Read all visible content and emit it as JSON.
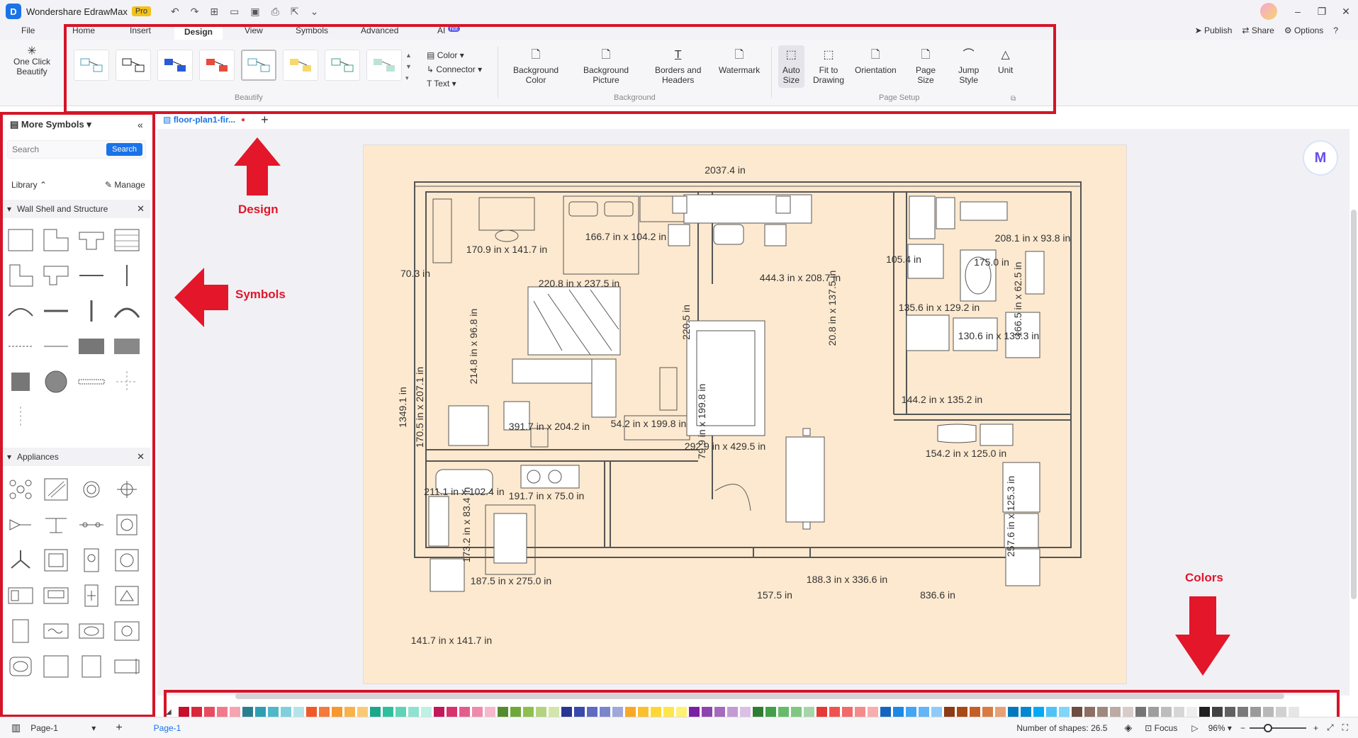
{
  "app": {
    "name": "Wondershare EdrawMax",
    "badge": "Pro"
  },
  "menu": {
    "file": "File",
    "tabs": [
      "Home",
      "Insert",
      "Design",
      "View",
      "Symbols",
      "Advanced",
      "AI"
    ],
    "ai_badge": "hot"
  },
  "topright": {
    "publish": "Publish",
    "share": "Share",
    "options": "Options"
  },
  "ribbon": {
    "one_click_line1": "One Click",
    "one_click_line2": "Beautify",
    "beautify_group": "Beautify",
    "options": [
      "Color",
      "Connector",
      "Text"
    ],
    "background_group": "Background",
    "page_setup_group": "Page Setup",
    "buttons": [
      {
        "line1": "Background",
        "line2": "Color"
      },
      {
        "line1": "Background",
        "line2": "Picture"
      },
      {
        "line1": "Borders and",
        "line2": "Headers"
      },
      {
        "line1": "Watermark",
        "line2": ""
      },
      {
        "line1": "Auto",
        "line2": "Size"
      },
      {
        "line1": "Fit to",
        "line2": "Drawing"
      },
      {
        "line1": "Orientation",
        "line2": ""
      },
      {
        "line1": "Page",
        "line2": "Size"
      },
      {
        "line1": "Jump",
        "line2": "Style"
      },
      {
        "line1": "Unit",
        "line2": ""
      }
    ]
  },
  "sidebar": {
    "title": "More Symbols",
    "search_placeholder": "Search",
    "search_button": "Search",
    "library": "Library",
    "manage": "Manage",
    "categories": [
      "Wall Shell and Structure",
      "Appliances"
    ]
  },
  "document": {
    "tab": "floor-plan1-fir...",
    "page": "Page-1"
  },
  "floorplan": {
    "labels": [
      "2037.4 in",
      "170.9 in x 141.7 in",
      "166.7 in x 104.2 in",
      "444.3 in x 208.7 in",
      "208.1 in x 93.8 in",
      "70.3 in",
      "214.8 in x 96.8 in",
      "220.8 in x 237.5 in",
      "220.5 in",
      "20.8 in x 137.5 in",
      "135.6 in x 129.2 in",
      "130.6 in x 133.3 in",
      "1349.1 in",
      "170.5 in x 207.1 in",
      "391.7 in x 204.2 in",
      "54.2 in x 199.8 in",
      "292.9 in x 429.5 in",
      "144.2 in x 135.2 in",
      "154.2 in x 125.0 in",
      "211.1 in x 102.4 in",
      "191.7 in x 75.0 in",
      "173.2 in x 83.4 in",
      "187.5 in x 275.0 in",
      "157.5 in",
      "188.3 in x 336.6 in",
      "836.6 in",
      "141.7 in x 141.7 in",
      "79.9 in x 199.8 in",
      "257.6 in x 125.3 in",
      "166.5 in x 62.5 in",
      "105.4 in",
      "175.0 in"
    ]
  },
  "annotations": {
    "design": "Design",
    "symbols": "Symbols",
    "colors": "Colors"
  },
  "status": {
    "shapes": "Number of shapes: 26.5",
    "focus": "Focus",
    "zoom": "96%"
  },
  "colors": [
    "#c8102e",
    "#d9263a",
    "#e94b5e",
    "#f07a8a",
    "#f6a4b0",
    "#2a7f8f",
    "#2e9fb3",
    "#4cb8c8",
    "#7fd0dc",
    "#b4e4ea",
    "#f05a28",
    "#f47a3d",
    "#f7972e",
    "#f9b24a",
    "#fbc976",
    "#1aa88a",
    "#2fbf9f",
    "#5fd3b8",
    "#8fe2cf",
    "#bff0e4",
    "#c2185b",
    "#d6336c",
    "#e35d8c",
    "#ee8bad",
    "#f5b8cc",
    "#558b2f",
    "#6fa83a",
    "#8fc04f",
    "#b2d47d",
    "#d2e6aa",
    "#283593",
    "#3949ab",
    "#5c6bc0",
    "#7986cb",
    "#9fa8da",
    "#f9a825",
    "#fbc02d",
    "#fdd835",
    "#ffe54c",
    "#fff176",
    "#7b1fa2",
    "#8e44ad",
    "#a569bd",
    "#c39bd3",
    "#dbbfe6",
    "#2e7d32",
    "#43a047",
    "#66bb6a",
    "#81c784",
    "#a5d6a7",
    "#e53935",
    "#ef5350",
    "#f06a6a",
    "#f48b8b",
    "#f7aeae",
    "#1565c0",
    "#1e88e5",
    "#42a5f5",
    "#64b5f6",
    "#90caf9",
    "#8d3b12",
    "#a84a16",
    "#c45e26",
    "#d97b44",
    "#e8a077",
    "#0277bd",
    "#0288d1",
    "#03a9f4",
    "#4fc3f7",
    "#81d4fa",
    "#6d4c41",
    "#8d6e63",
    "#a1887f",
    "#bcaaa4",
    "#d7ccc8",
    "#757575",
    "#9e9e9e",
    "#bdbdbd",
    "#d6d6d6",
    "#eeeeee",
    "#212121",
    "#424242",
    "#616161",
    "#7a7a7a",
    "#9a9a9a",
    "#b8b8b8",
    "#d0d0d0",
    "#e6e6e6"
  ]
}
